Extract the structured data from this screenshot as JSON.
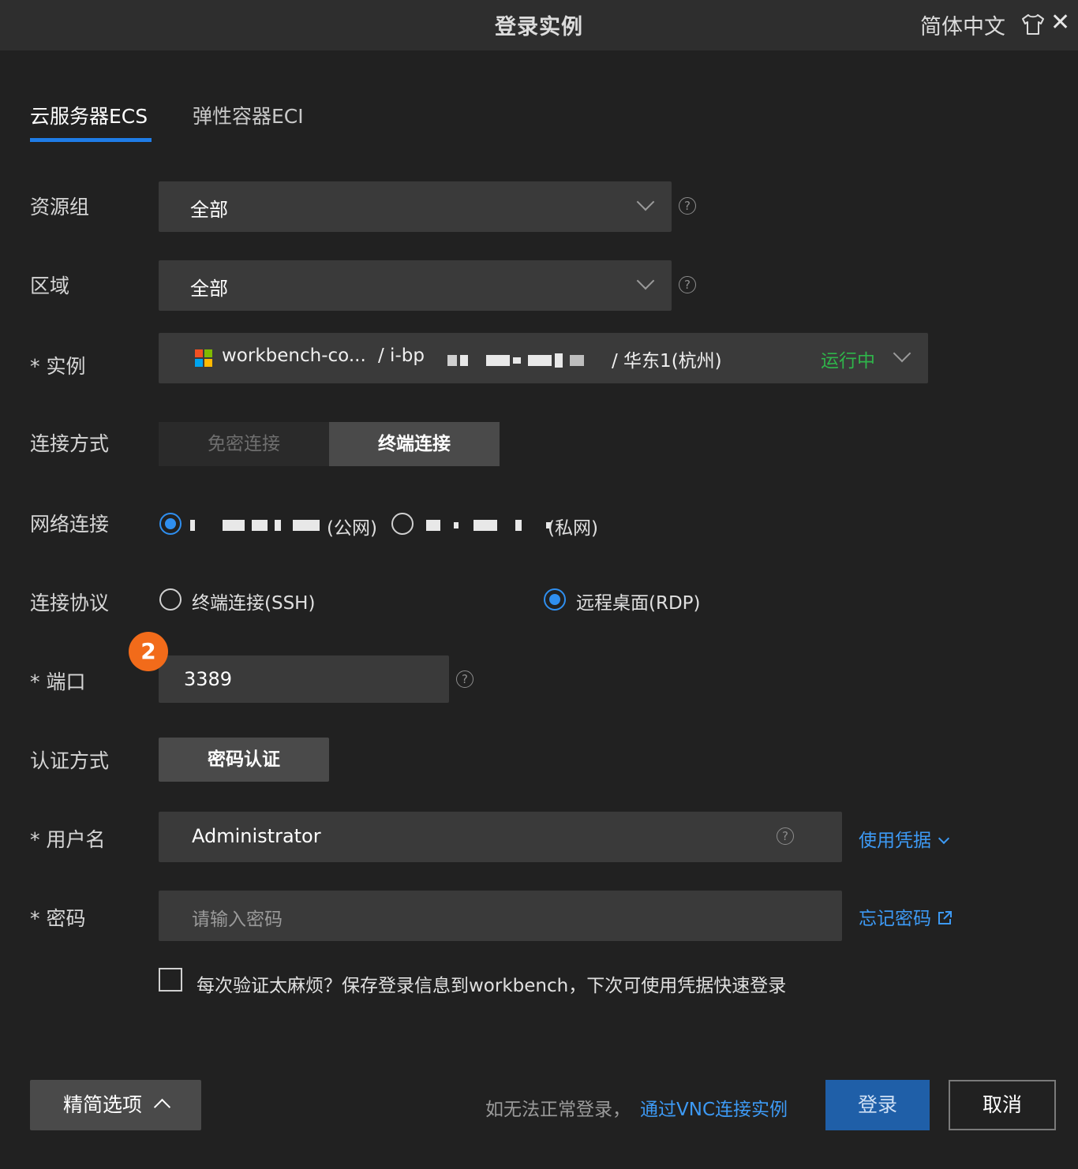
{
  "window": {
    "title": "登录实例",
    "language": "简体中文",
    "close_symbol": "✕"
  },
  "tabs": [
    {
      "label": "云服务器ECS",
      "active": true
    },
    {
      "label": "弹性容器ECI",
      "active": false
    }
  ],
  "form": {
    "resource_group": {
      "label": "资源组",
      "value": "全部"
    },
    "region": {
      "label": "区域",
      "value": "全部"
    },
    "instance": {
      "label": "* 实例",
      "name": "workbench-co...",
      "id_prefix": "/ i-bp",
      "region": "/ 华东1(杭州)",
      "status": "运行中",
      "status_color": "#2fb54a",
      "os_icon": "windows-logo-icon"
    },
    "connect_method": {
      "label": "连接方式",
      "options": [
        "免密连接",
        "终端连接"
      ],
      "selected": "终端连接"
    },
    "network": {
      "label": "网络连接",
      "options": [
        {
          "suffix": "(公网)",
          "checked": true
        },
        {
          "suffix": "(私网)",
          "checked": false
        }
      ]
    },
    "protocol": {
      "label": "连接协议",
      "options": [
        {
          "label": "终端连接(SSH)",
          "checked": false
        },
        {
          "label": "远程桌面(RDP)",
          "checked": true
        }
      ]
    },
    "port": {
      "label": "* 端口",
      "value": "3389",
      "badge": "2"
    },
    "auth": {
      "label": "认证方式",
      "button": "密码认证"
    },
    "username": {
      "label": "* 用户名",
      "value": "Administrator",
      "credential_link": "使用凭据"
    },
    "password": {
      "label": "* 密码",
      "placeholder": "请输入密码",
      "forgot_link": "忘记密码"
    },
    "save_checkbox": {
      "label": "每次验证太麻烦？保存登录信息到workbench，下次可使用凭据快速登录",
      "checked": false
    }
  },
  "footer": {
    "simplify_button": "精简选项",
    "hint": "如无法正常登录，",
    "vnc_link": "通过VNC连接实例",
    "login_button": "登录",
    "cancel_button": "取消"
  },
  "colors": {
    "accent": "#1f7ce6",
    "link": "#3d9af5",
    "login_button_bg": "#1f5fa8",
    "badge": "#f26b1a"
  }
}
